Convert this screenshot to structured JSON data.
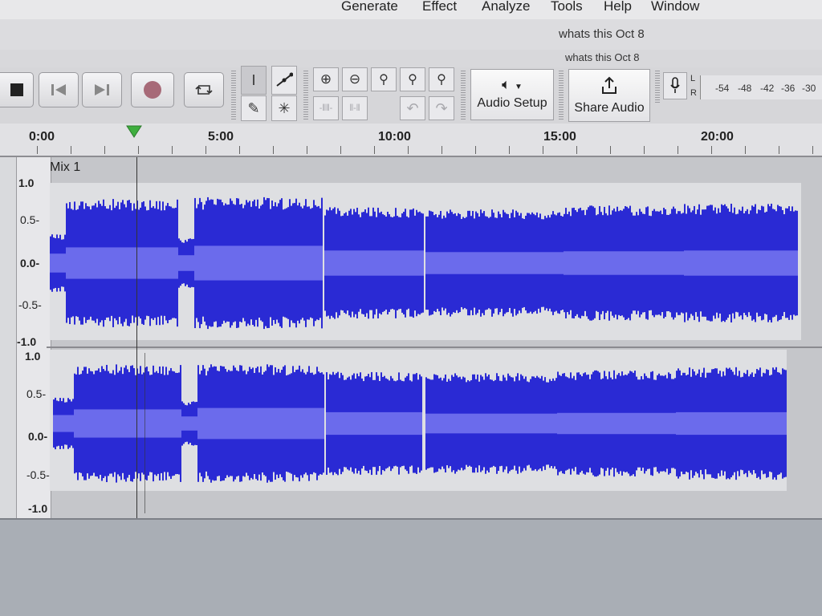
{
  "menu": [
    "Generate",
    "Effect",
    "Analyze",
    "Tools",
    "Help",
    "Window"
  ],
  "window_title": "whats this Oct 8",
  "window_subtitle": "whats this Oct 8",
  "toolbar": {
    "audio_setup_label": "Audio Setup",
    "share_audio_label": "Share Audio",
    "meter_lr": [
      "L",
      "R"
    ],
    "meter_ticks": [
      "-54",
      "-48",
      "-42",
      "-36",
      "-30"
    ]
  },
  "timeline": {
    "labels": [
      "0:00",
      "5:00",
      "10:00",
      "15:00",
      "20:00"
    ]
  },
  "track": {
    "name": "Mix 1",
    "channel1_ruler": [
      "1.0",
      "0.5-",
      "0.0-",
      "-0.5-",
      "-1.0"
    ],
    "channel2_ruler": [
      "1.0",
      "0.5-",
      "0.0-",
      "-0.5-",
      "-1.0"
    ]
  },
  "colors": {
    "waveform": "#2a2ad4",
    "waveform_rms": "#6b6bec",
    "playhead": "#3fae3f"
  },
  "icons": [
    "stop-icon",
    "skip-start-icon",
    "skip-end-icon",
    "record-icon",
    "loop-icon",
    "selection-tool-icon",
    "envelope-tool-icon",
    "draw-tool-icon",
    "multi-tool-icon",
    "zoom-in-icon",
    "zoom-out-icon",
    "fit-selection-icon",
    "fit-project-icon",
    "zoom-toggle-icon",
    "trim-icon",
    "silence-icon",
    "undo-icon",
    "redo-icon",
    "speaker-icon",
    "share-icon",
    "microphone-icon"
  ]
}
